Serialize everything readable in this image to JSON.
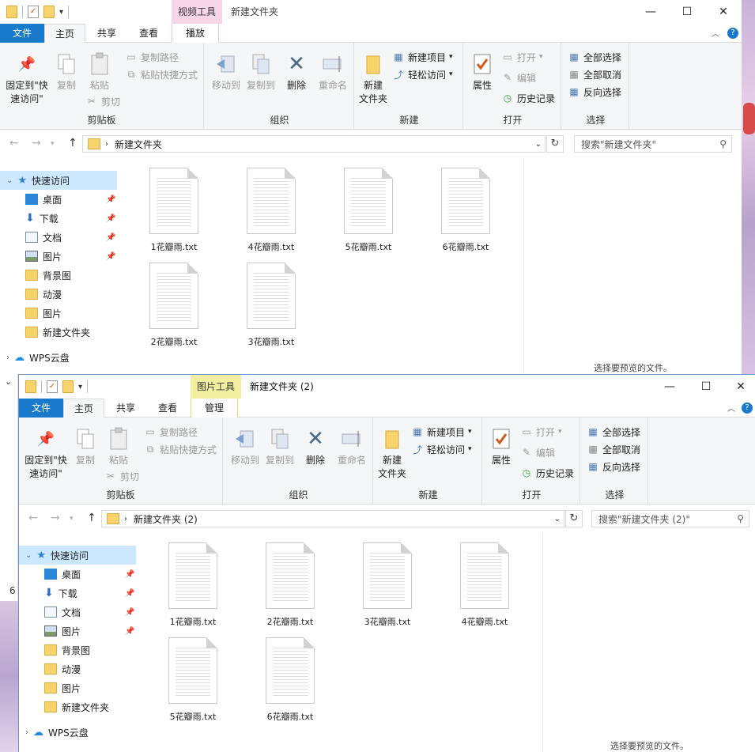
{
  "windows": [
    {
      "id": "w1",
      "context_tab_header": "视频工具",
      "title": "新建文件夹",
      "tabs": {
        "file": "文件",
        "home": "主页",
        "share": "共享",
        "view": "查看",
        "context": "播放"
      },
      "ribbon": {
        "pin_label": "固定到\"快\n速访问\"",
        "copy": "复制",
        "paste": "粘贴",
        "copy_path": "复制路径",
        "paste_shortcut": "粘贴快捷方式",
        "cut": "剪切",
        "clipboard": "剪贴板",
        "move_to": "移动到",
        "copy_to": "复制到",
        "delete": "删除",
        "rename": "重命名",
        "organize": "组织",
        "new_folder": "新建\n文件夹",
        "new_item": "新建项目",
        "easy_access": "轻松访问",
        "new": "新建",
        "properties": "属性",
        "open_btn": "打开",
        "edit": "编辑",
        "history": "历史记录",
        "open": "打开",
        "select_all": "全部选择",
        "select_none": "全部取消",
        "invert": "反向选择",
        "select": "选择"
      },
      "address": "新建文件夹",
      "search_placeholder": "搜索\"新建文件夹\"",
      "nav": [
        {
          "label": "快速访问",
          "sel": true
        },
        {
          "label": "桌面"
        },
        {
          "label": "下载"
        },
        {
          "label": "文档"
        },
        {
          "label": "图片"
        },
        {
          "label": "背景图"
        },
        {
          "label": "动漫"
        },
        {
          "label": "图片"
        },
        {
          "label": "新建文件夹"
        },
        {
          "label": "WPS云盘"
        }
      ],
      "files": [
        "1花瓣雨.txt",
        "4花瓣雨.txt",
        "5花瓣雨.txt",
        "6花瓣雨.txt",
        "2花瓣雨.txt",
        "3花瓣雨.txt"
      ],
      "preview_text": "选择要预览的文件。"
    },
    {
      "id": "w2",
      "context_tab_header": "图片工具",
      "title": "新建文件夹 (2)",
      "tabs": {
        "file": "文件",
        "home": "主页",
        "share": "共享",
        "view": "查看",
        "context": "管理"
      },
      "ribbon": {
        "pin_label": "固定到\"快\n速访问\"",
        "copy": "复制",
        "paste": "粘贴",
        "copy_path": "复制路径",
        "paste_shortcut": "粘贴快捷方式",
        "cut": "剪切",
        "clipboard": "剪贴板",
        "move_to": "移动到",
        "copy_to": "复制到",
        "delete": "删除",
        "rename": "重命名",
        "organize": "组织",
        "new_folder": "新建\n文件夹",
        "new_item": "新建项目",
        "easy_access": "轻松访问",
        "new": "新建",
        "properties": "属性",
        "open_btn": "打开",
        "edit": "编辑",
        "history": "历史记录",
        "open": "打开",
        "select_all": "全部选择",
        "select_none": "全部取消",
        "invert": "反向选择",
        "select": "选择"
      },
      "address": "新建文件夹 (2)",
      "search_placeholder": "搜索\"新建文件夹 (2)\"",
      "nav": [
        {
          "label": "快速访问",
          "sel": true
        },
        {
          "label": "桌面"
        },
        {
          "label": "下载"
        },
        {
          "label": "文档"
        },
        {
          "label": "图片"
        },
        {
          "label": "背景图"
        },
        {
          "label": "动漫"
        },
        {
          "label": "图片"
        },
        {
          "label": "新建文件夹"
        },
        {
          "label": "WPS云盘"
        }
      ],
      "files": [
        "1花瓣雨.txt",
        "2花瓣雨.txt",
        "3花瓣雨.txt",
        "4花瓣雨.txt",
        "5花瓣雨.txt",
        "6花瓣雨.txt"
      ],
      "preview_text": "选择要预览的文件。"
    }
  ],
  "background_fragment": "6",
  "colors": {
    "file_tab": "#1979ca",
    "context_header_1": "#f6d6e6",
    "context_header_2": "#f3efa0",
    "selection": "#cce8ff"
  }
}
